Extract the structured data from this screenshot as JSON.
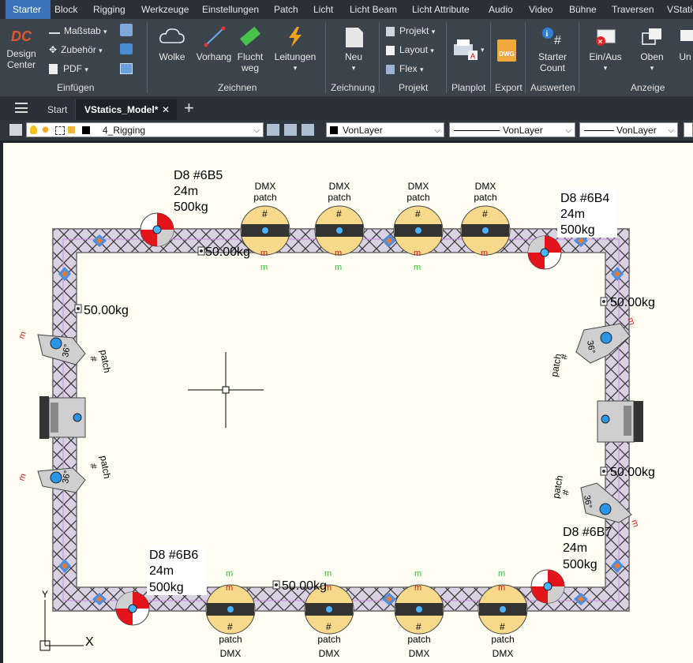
{
  "menu": [
    "Starter",
    "Block",
    "Rigging",
    "Werkzeuge",
    "Einstellungen",
    "Patch",
    "Licht",
    "Licht Beam",
    "Licht Attribute",
    "Audio",
    "Video",
    "Bühne",
    "Traversen",
    "VStatic"
  ],
  "ribbon": {
    "design_center": [
      "Design",
      "Center"
    ],
    "massstab": "Maßstab",
    "zubehoer": "Zubehör",
    "pdf": "PDF",
    "wolke": "Wolke",
    "vorhang": "Vorhang",
    "flucht": [
      "Flucht",
      "weg"
    ],
    "leitungen": "Leitungen",
    "neu": "Neu",
    "projekt": "Projekt",
    "layout": "Layout",
    "flex": "Flex",
    "starter_count": [
      "Starter",
      "Count"
    ],
    "ein_aus": "Ein/Aus",
    "oben": "Oben",
    "un": "Un",
    "groups": {
      "einfuegen": "Einfügen",
      "zeichnen": "Zeichnen",
      "zeichnung": "Zeichnung",
      "projekt": "Projekt",
      "planplot": "Planplot",
      "export": "Export",
      "auswerten": "Auswerten",
      "anzeige": "Anzeige"
    },
    "dwg": "DWG"
  },
  "tabs": {
    "start": "Start",
    "model": "VStatics_Model*"
  },
  "props": {
    "layer": "4_Rigging",
    "color": "VonLayer",
    "linetype": "VonLayer",
    "lineweight": "VonLayer"
  },
  "drawing": {
    "hoists": [
      {
        "name": "D8  #6B5",
        "len": "24m",
        "load": "500kg"
      },
      {
        "name": "D8  #6B4",
        "len": "24m",
        "load": "500kg"
      },
      {
        "name": "D8  #6B6",
        "len": "24m",
        "load": "500kg"
      },
      {
        "name": "D8  #6B7",
        "len": "24m",
        "load": "500kg"
      }
    ],
    "weight_label": "50.00kg",
    "dmx": "DMX",
    "patch": "patch",
    "hash": "#",
    "m": "m",
    "angle": "36°",
    "ucs_y": "Y",
    "ucs_x": "X"
  },
  "colors": {
    "accent": "#3b74b8",
    "canvas": "#fffef3",
    "truss": "#c9c1d8",
    "fixture": "#f7d98b",
    "hoist_red": "#e4141b"
  }
}
